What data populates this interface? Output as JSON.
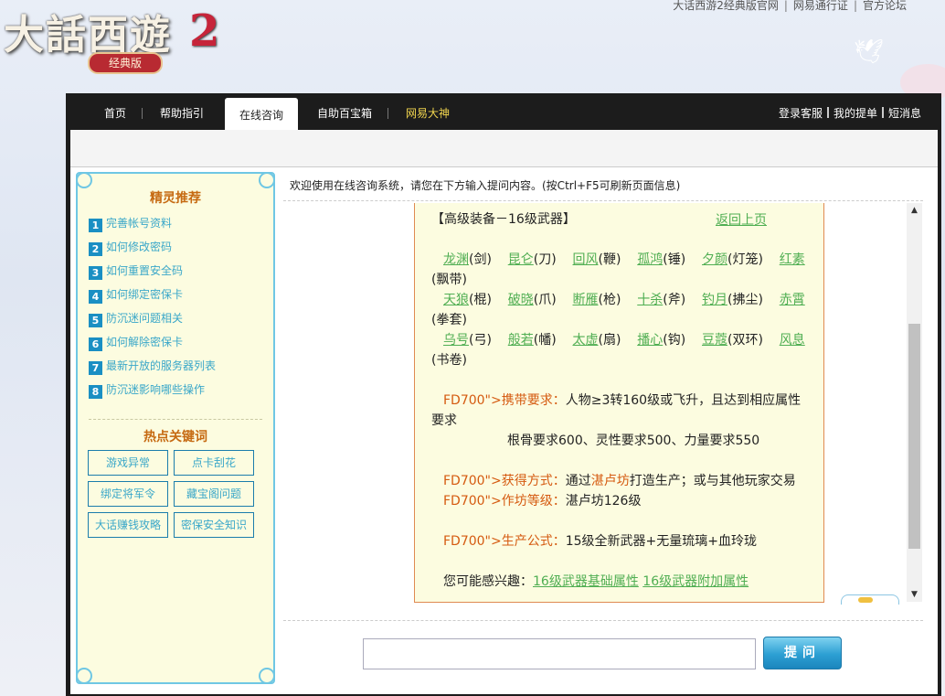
{
  "logo": {
    "main": "大話西遊",
    "number": "2",
    "sub": "经典版"
  },
  "top_links": [
    "大话西游2经典版官网",
    "网易通行证",
    "官方论坛"
  ],
  "nav": {
    "tabs": [
      "首页",
      "帮助指引",
      "在线咨询",
      "自助百宝箱",
      "网易大神"
    ],
    "active": "在线咨询",
    "right": [
      "登录客服",
      "我的提单",
      "短消息"
    ]
  },
  "sidebar": {
    "recommend_title": "精灵推荐",
    "items": [
      {
        "num": "1",
        "label": "完善帐号资料"
      },
      {
        "num": "2",
        "label": "如何修改密码"
      },
      {
        "num": "3",
        "label": "如何重置安全码"
      },
      {
        "num": "4",
        "label": "如何绑定密保卡"
      },
      {
        "num": "5",
        "label": "防沉迷问题相关"
      },
      {
        "num": "6",
        "label": "如何解除密保卡"
      },
      {
        "num": "7",
        "label": "最新开放的服务器列表"
      },
      {
        "num": "8",
        "label": "防沉迷影响哪些操作"
      }
    ],
    "hot_title": "热点关键词",
    "keywords": [
      "游戏异常",
      "点卡刮花",
      "绑定将军令",
      "藏宝阁问题",
      "大话赚钱攻略",
      "密保安全知识"
    ]
  },
  "welcome": "欢迎使用在线咨询系统，请您在下方输入提问内容。(按Ctrl+F5可刷新页面信息)",
  "answer": {
    "heading": "【高级装备－16级武器】",
    "back": "返回上页",
    "weapons": {
      "w1": "龙渊",
      "t1": "(剑)",
      "w2": "昆仑",
      "t2": "(刀)",
      "w3": "回风",
      "t3": "(鞭)",
      "w4": "孤鸿",
      "t4": "(锤)",
      "w5": "夕颜",
      "t5": "(灯笼)",
      "w6": "红素",
      "t6": "(飘带)",
      "w7": "天狼",
      "t7": "(棍)",
      "w8": "破晓",
      "t8": "(爪)",
      "w9": "断雁",
      "t9": "(枪)",
      "w10": "十杀",
      "t10": "(斧)",
      "w11": "钓月",
      "t11": "(拂尘)",
      "w12": "赤霄",
      "t12": "(拳套)",
      "w13": "乌号",
      "t13": "(弓)",
      "w14": "般若",
      "t14": "(幡)",
      "w15": "太虚",
      "t15": "(扇)",
      "w16": "播心",
      "t16": "(钩)",
      "w17": "豆蔻",
      "t17": "(双环)",
      "w18": "风息",
      "t18": "(书卷)"
    },
    "carry_label": "FD700\">携带要求：",
    "carry_text": "人物≥3转160级或飞升，且达到相应属性",
    "carry_text2": "要求",
    "carry_req": "根骨要求600、灵性要求500、力量要求550",
    "obtain_label": "FD700\">获得方式：",
    "obtain_pre": "通过",
    "obtain_place": "湛卢坊",
    "obtain_post": "打造生产；或与其他玩家交易",
    "level_label": "FD700\">作坊等级：",
    "level_text": "湛卢坊126级",
    "formula_label": "FD700\">生产公式：",
    "formula_text": "15级全新武器+无量琉璃+血玲珑",
    "interest_label": "您可能感兴趣：",
    "interest_links": [
      "16级武器基础属性",
      "16级武器附加属性"
    ]
  },
  "ask_button": "提问",
  "colors": {
    "accent_blue": "#1a8fc3",
    "link_green": "#4fae52",
    "orange": "#d55a10",
    "nav_bg": "#1c1c1c"
  }
}
